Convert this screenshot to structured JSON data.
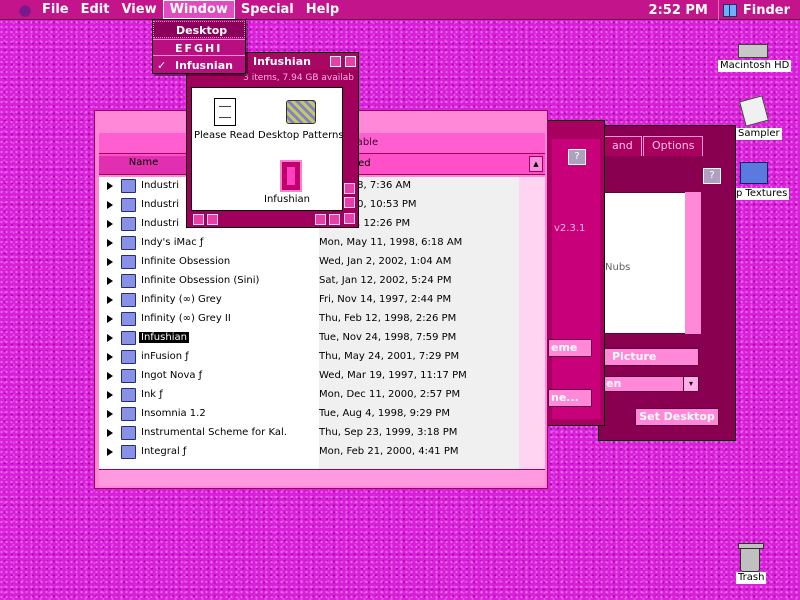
{
  "menubar": {
    "menus": [
      "File",
      "Edit",
      "View",
      "Window",
      "Special",
      "Help"
    ],
    "clock": "2:52 PM",
    "app": "Finder"
  },
  "window_menu": {
    "items": [
      "Desktop",
      "EFGHI",
      "Infusnian"
    ],
    "check": "✓"
  },
  "infushian_window": {
    "title": "Infushian",
    "status": "3 items, 7.94 GB availab",
    "icons": [
      "Please Read",
      "Desktop Patterns",
      "Infushian"
    ]
  },
  "list_window": {
    "top_text": "ailable",
    "col_name": "Name",
    "col_modified": "ified",
    "rows": [
      {
        "name": "Industri",
        "date": "22, 1998, 7:36 AM"
      },
      {
        "name": "Industri",
        "date": "18, 2000, 10:53 PM"
      },
      {
        "name": "Industri",
        "date": "3, 1999, 12:26 PM"
      },
      {
        "name": "Indy's iMac ƒ",
        "date": "Mon, May 11, 1998, 6:18 AM"
      },
      {
        "name": "Infinite Obsession",
        "date": "Wed, Jan 2, 2002, 1:04 AM"
      },
      {
        "name": "Infinite Obsession (Sini)",
        "date": "Sat, Jan 12, 2002, 5:24 PM"
      },
      {
        "name": "Infinity (∞) Grey",
        "date": "Fri, Nov 14, 1997, 2:44 PM"
      },
      {
        "name": "Infinity (∞) Grey II",
        "date": "Thu, Feb 12, 1998, 2:26 PM"
      },
      {
        "name": "Infushian",
        "date": "Tue, Nov 24, 1998, 7:59 PM"
      },
      {
        "name": "inFusion ƒ",
        "date": "Thu, May 24, 2001, 7:29 PM"
      },
      {
        "name": "Ingot Nova ƒ",
        "date": "Wed, Mar 19, 1997, 11:17 PM"
      },
      {
        "name": "Ink ƒ",
        "date": "Mon, Dec 11, 2000, 2:57 PM"
      },
      {
        "name": "Insomnia 1.2",
        "date": "Tue, Aug 4, 1998, 9:29 PM"
      },
      {
        "name": "Instrumental Scheme for Kal.",
        "date": "Thu, Sep 23, 1999, 3:18 PM"
      },
      {
        "name": "Integral ƒ",
        "date": "Mon, Feb 21, 2000, 4:41 PM"
      }
    ]
  },
  "mid_window": {
    "question": "?",
    "version": "v2.3.1",
    "btn_scheme": "eme",
    "btn_name": "ne..."
  },
  "right_window": {
    "tab1": "and",
    "tab2": "Options",
    "question": "?",
    "preview_text": "Nubs",
    "btn_picture": "Picture",
    "popup": "en",
    "popup_arrow": "▾",
    "btn_set_desktop": "Set Desktop"
  },
  "desktop": {
    "hd": "Macintosh HD",
    "sampler": "Sampler",
    "textures": "p Textures",
    "trash": "Trash"
  }
}
